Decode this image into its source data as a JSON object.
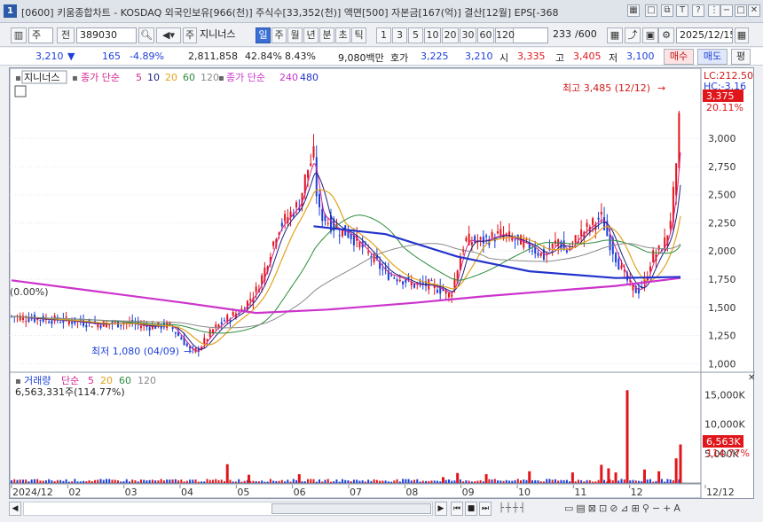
{
  "title": "[0600] 키움종합차트 - KOSDAQ 외국인보유[966(천)] 주식수[33,352(천)] 액면[500] 자본금[167(억)] 결산[12월] EPS[-368",
  "toolbar": {
    "unit_label": "주",
    "period_type": "전",
    "code": "389030",
    "stock_name": "지니너스",
    "periods": [
      "일",
      "주",
      "월",
      "년",
      "분",
      "초",
      "틱"
    ],
    "active_period": "일",
    "intervals": [
      "1",
      "3",
      "5",
      "10",
      "20",
      "30",
      "60",
      "120"
    ],
    "count": "233",
    "count_max": "/600",
    "date": "2025/12/15"
  },
  "quote": {
    "price": "3,210",
    "change": "165",
    "change_pct": "-4.89%",
    "volume": "2,811,858",
    "vol_ratio": "42.84%",
    "turnover": "8.43%",
    "amount": "9,080백만",
    "bid_label": "호가",
    "bid1": "3,225",
    "bid2": "3,210",
    "open_label": "시",
    "open": "3,335",
    "high_label": "고",
    "high": "3,405",
    "low_label": "저",
    "low": "3,100",
    "buy_label": "매수",
    "sell_label": "매도",
    "flat_label": "평"
  },
  "price_panel": {
    "legend_name": "지니너스",
    "ma_label": "종가 단순",
    "ma_periods": [
      "5",
      "10",
      "20",
      "60",
      "120"
    ],
    "ma_long_label": "종가 단순",
    "ma_long_periods": [
      "240",
      "480"
    ],
    "lc_label": "LC:212.50",
    "hc_label": "HC:-3.16",
    "high_annot": "최고 3,485 (12/12)",
    "low_annot": "최저 1,080 (04/09)",
    "left_value": "0.00%)",
    "current_tag": "3,375",
    "current_pct_tag": "20.11%"
  },
  "volume_panel": {
    "label": "거래량",
    "ma_label": "단순",
    "ma_periods": [
      "5",
      "20",
      "60",
      "120"
    ],
    "value": "6,563,331주(114.77%)",
    "current_tag": "6,563K",
    "current_pct_tag": "114.77%"
  },
  "colors": {
    "up": "#e0161b",
    "down": "#1d3fd8",
    "ma5": "#d6268f",
    "ma10": "#1a237e",
    "ma20": "#e3a21a",
    "ma60": "#2e8b3c",
    "ma120": "#8a8a8a",
    "ma240": "#cc33cc",
    "ma480": "#2233cc"
  },
  "chart_data": {
    "type": "candlestick",
    "price_axis_ticks": [
      "3,375",
      "3,000",
      "2,750",
      "2,500",
      "2,250",
      "2,000",
      "1,750",
      "1,500",
      "1,250",
      "1,000"
    ],
    "price_tick_values": [
      3375,
      3000,
      2750,
      2500,
      2250,
      2000,
      1750,
      1500,
      1250,
      1000
    ],
    "volume_axis_ticks": [
      "15,000K",
      "10,000K",
      "5,000K"
    ],
    "volume_tick_values": [
      15000,
      10000,
      5000
    ],
    "x_tick_labels": [
      "2024/12",
      "02",
      "03",
      "04",
      "05",
      "06",
      "07",
      "08",
      "09",
      "10",
      "11",
      "12",
      "12/12"
    ],
    "ylim": [
      900,
      3560
    ],
    "vol_lim": [
      0,
      17200
    ],
    "close_path": [
      [
        0,
        1420
      ],
      [
        15,
        1400
      ],
      [
        40,
        1380
      ],
      [
        60,
        1350
      ],
      [
        80,
        1360
      ],
      [
        95,
        1330
      ],
      [
        110,
        1340
      ],
      [
        120,
        1190
      ],
      [
        125,
        1100
      ],
      [
        130,
        1130
      ],
      [
        140,
        1300
      ],
      [
        150,
        1400
      ],
      [
        160,
        1480
      ],
      [
        170,
        1650
      ],
      [
        175,
        1800
      ],
      [
        185,
        2200
      ],
      [
        195,
        2350
      ],
      [
        200,
        2420
      ],
      [
        205,
        2700
      ],
      [
        210,
        2850
      ],
      [
        213,
        2350
      ],
      [
        225,
        2200
      ],
      [
        235,
        2150
      ],
      [
        250,
        1950
      ],
      [
        260,
        1800
      ],
      [
        270,
        1760
      ],
      [
        280,
        1700
      ],
      [
        290,
        1700
      ],
      [
        300,
        1650
      ],
      [
        305,
        1600
      ],
      [
        310,
        1850
      ],
      [
        315,
        2100
      ],
      [
        325,
        2080
      ],
      [
        340,
        2150
      ],
      [
        350,
        2100
      ],
      [
        360,
        2050
      ],
      [
        370,
        1950
      ],
      [
        380,
        2100
      ],
      [
        385,
        1980
      ],
      [
        395,
        2150
      ],
      [
        400,
        2200
      ],
      [
        410,
        2300
      ],
      [
        415,
        2100
      ],
      [
        420,
        1950
      ],
      [
        425,
        1800
      ],
      [
        430,
        1690
      ],
      [
        435,
        1640
      ],
      [
        440,
        1720
      ],
      [
        445,
        1950
      ],
      [
        450,
        2000
      ],
      [
        455,
        2100
      ],
      [
        458,
        2300
      ],
      [
        462,
        2700
      ],
      [
        465,
        3375
      ]
    ],
    "long_ma": [
      [
        0,
        1740
      ],
      [
        60,
        1640
      ],
      [
        120,
        1540
      ],
      [
        170,
        1450
      ],
      [
        220,
        1480
      ],
      [
        280,
        1540
      ],
      [
        330,
        1600
      ],
      [
        380,
        1650
      ],
      [
        420,
        1690
      ],
      [
        465,
        1760
      ]
    ],
    "bold_trend": [
      [
        210,
        2220
      ],
      [
        260,
        2150
      ],
      [
        310,
        1950
      ],
      [
        360,
        1820
      ],
      [
        420,
        1760
      ],
      [
        465,
        1770
      ]
    ],
    "vol_spikes": [
      [
        150,
        3200
      ],
      [
        165,
        1400
      ],
      [
        200,
        1500
      ],
      [
        300,
        1000
      ],
      [
        310,
        1700
      ],
      [
        330,
        1500
      ],
      [
        360,
        2000
      ],
      [
        390,
        1800
      ],
      [
        410,
        3100
      ],
      [
        415,
        2500
      ],
      [
        420,
        1800
      ],
      [
        428,
        15800
      ],
      [
        440,
        2300
      ],
      [
        450,
        2000
      ],
      [
        462,
        4200
      ],
      [
        465,
        6563
      ]
    ]
  }
}
